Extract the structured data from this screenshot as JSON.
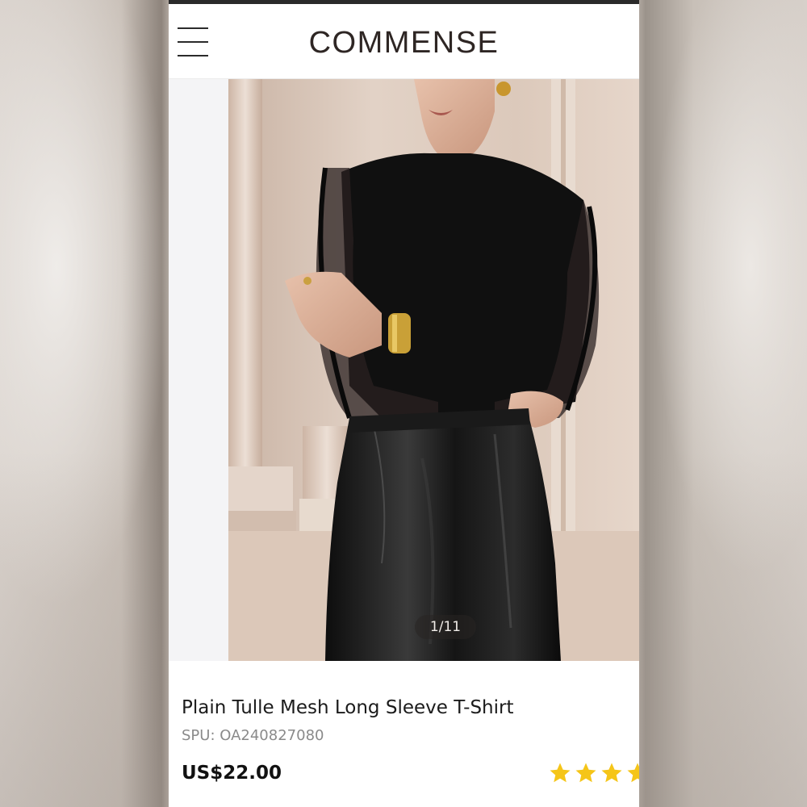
{
  "brand": {
    "logo_text": "COMMENSE"
  },
  "header": {
    "menu_icon": "hamburger-menu-icon"
  },
  "gallery": {
    "counter_text": "1/11",
    "image_alt": "Model wearing black tulle mesh long sleeve top with black leather skirt"
  },
  "product": {
    "title": "Plain Tulle Mesh Long Sleeve T-Shirt",
    "spu": "SPU: OA240827080",
    "price": "US$22.00",
    "rating_stars_visible": 4,
    "star_icon": "star-icon",
    "star_color": "#f5c518"
  },
  "colors": {
    "header_background": "#ffffff",
    "text_primary": "#1b1b1b",
    "text_secondary": "#8a8a8a"
  }
}
